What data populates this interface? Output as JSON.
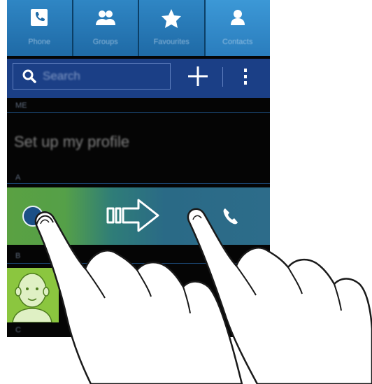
{
  "tabs": [
    {
      "label": "Phone",
      "icon": "phone-icon"
    },
    {
      "label": "Groups",
      "icon": "groups-icon"
    },
    {
      "label": "Favourites",
      "icon": "star-icon"
    },
    {
      "label": "Contacts",
      "icon": "contact-icon",
      "active": true
    }
  ],
  "search": {
    "placeholder": "Search"
  },
  "sections": {
    "me": "ME",
    "a": "A",
    "b": "B",
    "c": "C"
  },
  "profile": {
    "label": "Set up my profile"
  },
  "colors": {
    "tab_blue": "#2a7dbd",
    "search_bar": "#1b3f86",
    "swipe_green": "#5aa142",
    "swipe_blue": "#2d6c8a",
    "avatar_green": "#8bc63f"
  }
}
